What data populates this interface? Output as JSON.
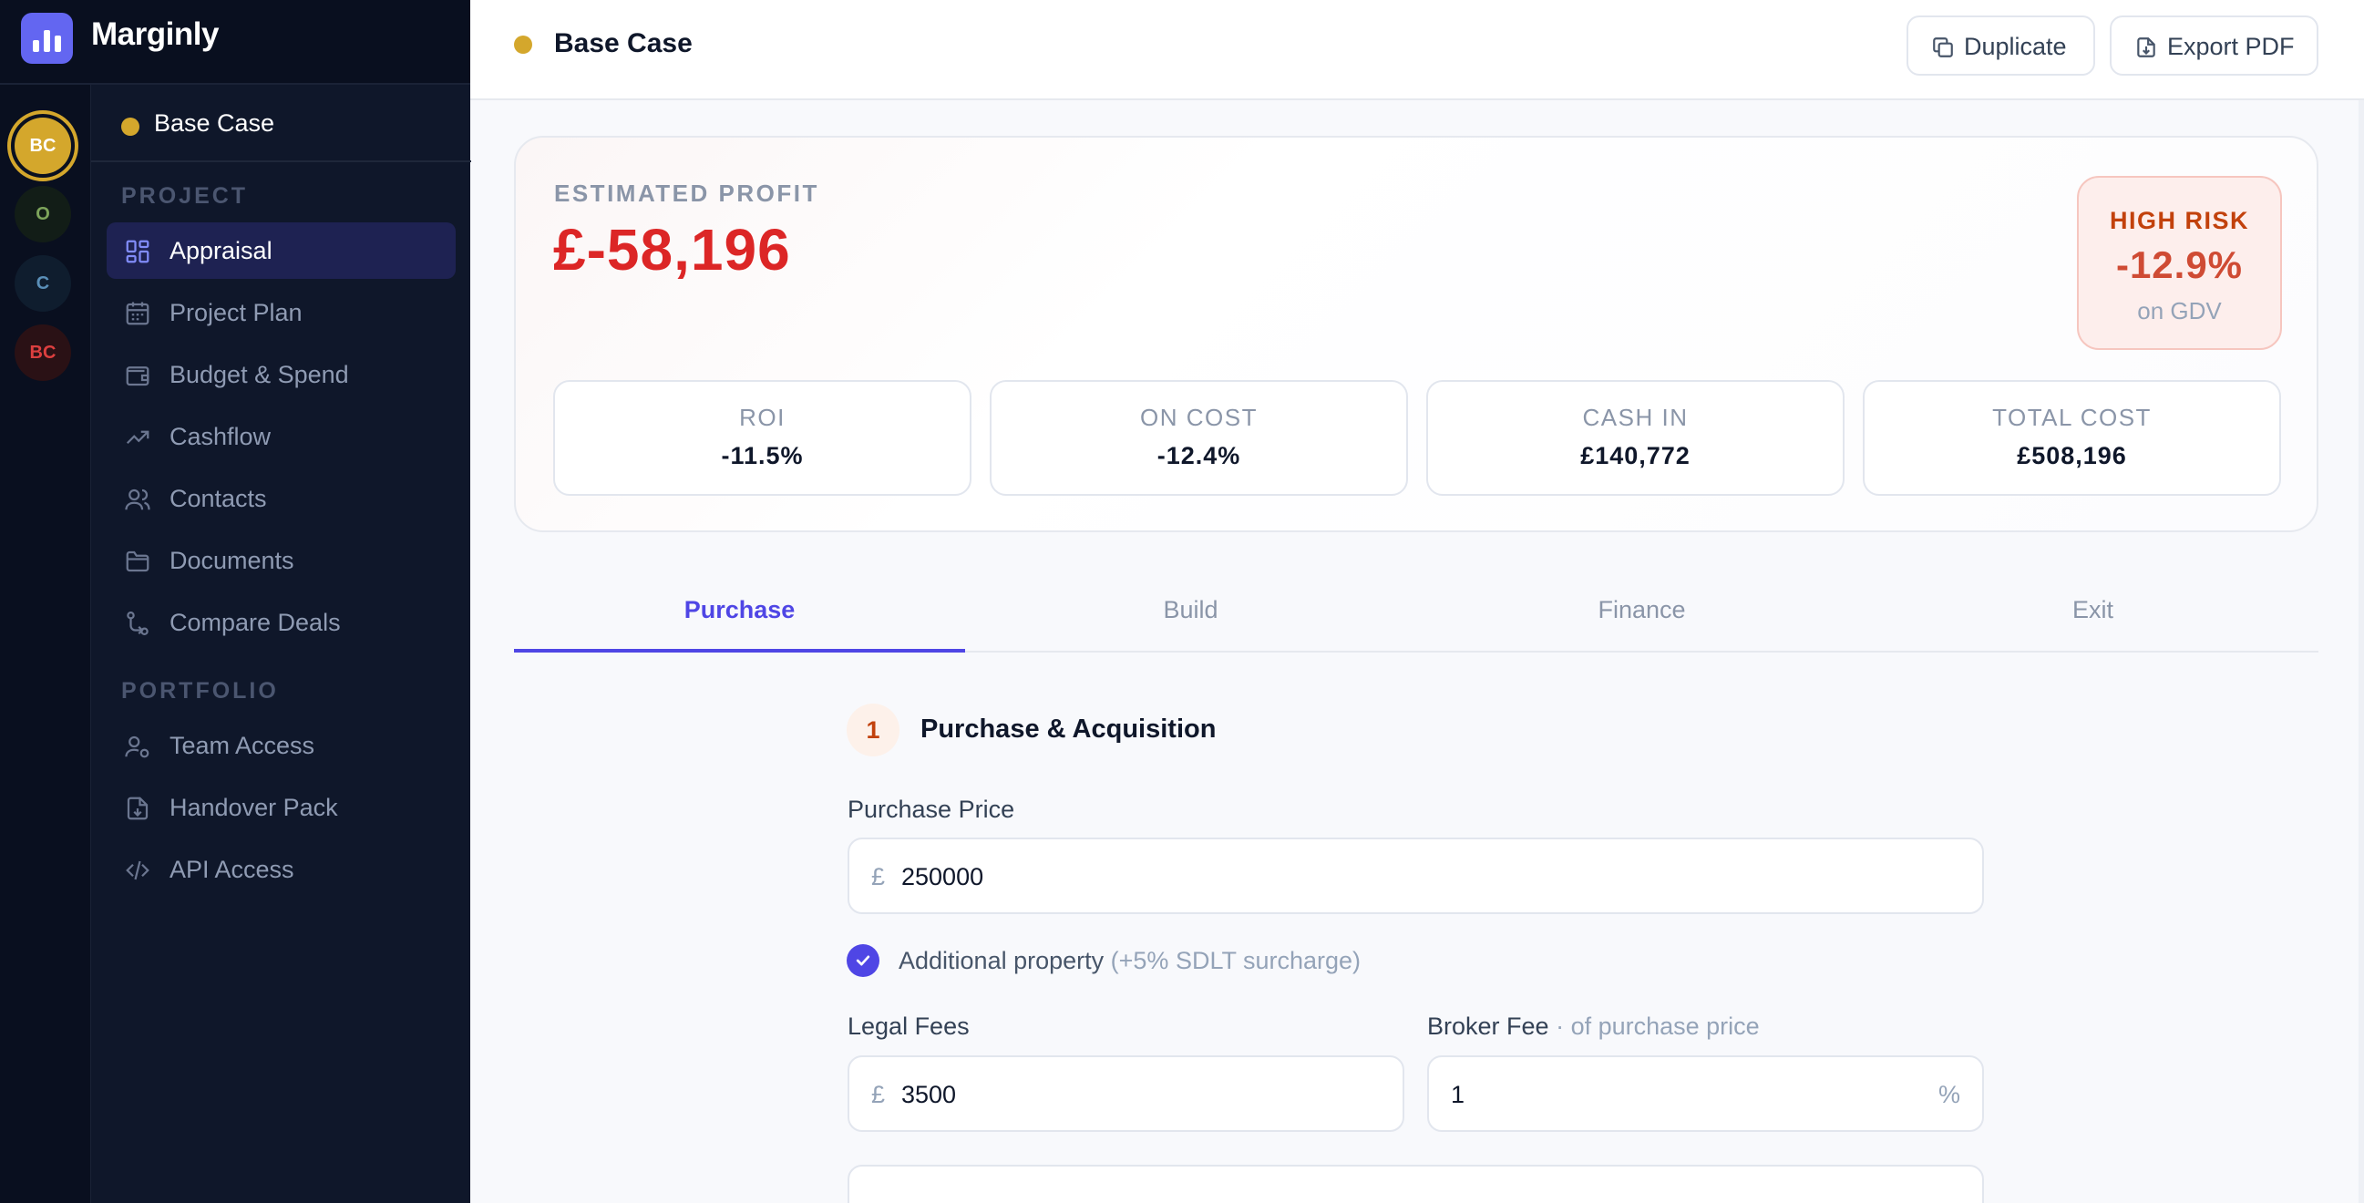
{
  "app": {
    "name": "Marginly"
  },
  "rail": {
    "avatars": [
      {
        "initials": "BC",
        "color": "#d4a72c",
        "active": true
      },
      {
        "initials": "O",
        "color": "#7da45b"
      },
      {
        "initials": "C",
        "color": "#5a8fb8"
      },
      {
        "initials": "BC",
        "color": "#dc3f3f"
      }
    ]
  },
  "sidebar": {
    "current_case": "Base Case",
    "project_section": "PROJECT",
    "portfolio_section": "PORTFOLIO",
    "project_items": [
      {
        "label": "Appraisal",
        "icon": "grid-icon",
        "active": true
      },
      {
        "label": "Project Plan",
        "icon": "calendar-icon"
      },
      {
        "label": "Budget & Spend",
        "icon": "wallet-icon"
      },
      {
        "label": "Cashflow",
        "icon": "trend-icon"
      },
      {
        "label": "Contacts",
        "icon": "users-icon"
      },
      {
        "label": "Documents",
        "icon": "folder-icon"
      },
      {
        "label": "Compare Deals",
        "icon": "compare-icon"
      }
    ],
    "portfolio_items": [
      {
        "label": "Team Access",
        "icon": "user-settings-icon"
      },
      {
        "label": "Handover Pack",
        "icon": "file-download-icon"
      },
      {
        "label": "API Access",
        "icon": "code-icon"
      }
    ]
  },
  "header": {
    "title": "Base Case",
    "duplicate_label": "Duplicate",
    "export_label": "Export PDF"
  },
  "summary": {
    "profit_label": "ESTIMATED PROFIT",
    "profit_value": "£-58,196",
    "risk_label": "HIGH RISK",
    "risk_value": "-12.9%",
    "risk_sub": "on GDV",
    "stats": [
      {
        "label": "ROI",
        "value": "-11.5%"
      },
      {
        "label": "ON COST",
        "value": "-12.4%"
      },
      {
        "label": "CASH IN",
        "value": "£140,772"
      },
      {
        "label": "TOTAL COST",
        "value": "£508,196"
      }
    ]
  },
  "tabs": [
    {
      "label": "Purchase",
      "active": true
    },
    {
      "label": "Build"
    },
    {
      "label": "Finance"
    },
    {
      "label": "Exit"
    }
  ],
  "form": {
    "step_number": "1",
    "section_title": "Purchase & Acquisition",
    "purchase_price_label": "Purchase Price",
    "currency_symbol": "£",
    "purchase_price_value": "250000",
    "additional_property_label": "Additional property",
    "additional_property_hint": "(+5% SDLT surcharge)",
    "additional_property_checked": true,
    "legal_fees_label": "Legal Fees",
    "legal_fees_value": "3500",
    "broker_fee_label": "Broker Fee",
    "broker_fee_hint": "· of purchase price",
    "broker_fee_value": "1",
    "percent_symbol": "%"
  },
  "colors": {
    "accent": "#4f46e5",
    "negative": "#dc2626",
    "case_dot": "#d4a72c",
    "sidebar_bg": "#0f172a"
  }
}
